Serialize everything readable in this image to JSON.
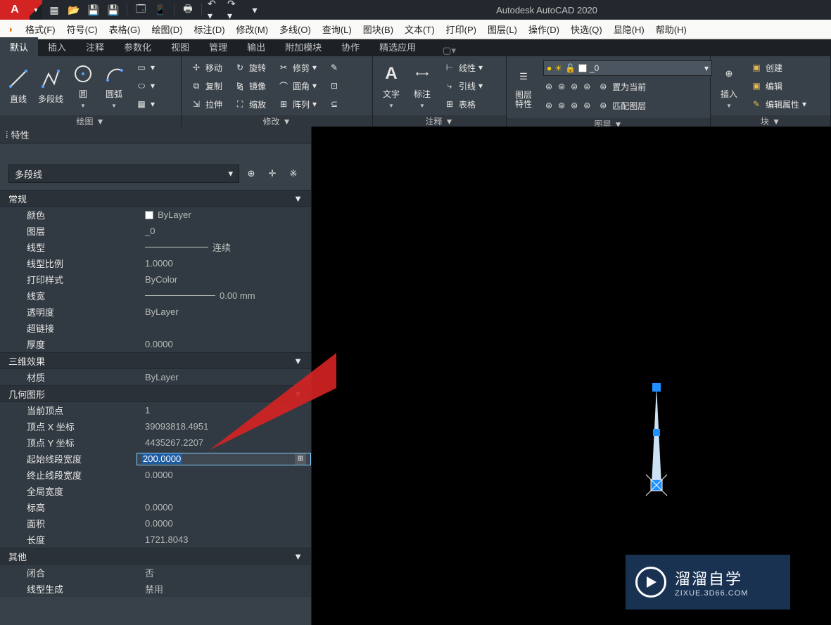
{
  "app": {
    "title": "Autodesk AutoCAD 2020",
    "logo": "A"
  },
  "menubar": [
    "格式(F)",
    "符号(C)",
    "表格(G)",
    "绘图(D)",
    "标注(D)",
    "修改(M)",
    "多线(O)",
    "查询(L)",
    "图块(B)",
    "文本(T)",
    "打印(P)",
    "图层(L)",
    "操作(D)",
    "快选(Q)",
    "显隐(H)",
    "帮助(H)"
  ],
  "ribbon_tabs": [
    "默认",
    "插入",
    "注释",
    "参数化",
    "视图",
    "管理",
    "输出",
    "附加模块",
    "协作",
    "精选应用"
  ],
  "ribbon": {
    "draw": {
      "title": "绘图",
      "btns": [
        "直线",
        "多段线",
        "圆",
        "圆弧"
      ]
    },
    "modify": {
      "title": "修改",
      "move": "移动",
      "rotate": "旋转",
      "trim": "修剪",
      "copy": "复制",
      "mirror": "镜像",
      "fillet": "圆角",
      "stretch": "拉伸",
      "scale": "缩放",
      "array": "阵列"
    },
    "annotate": {
      "title": "注释",
      "text": "文字",
      "dim": "标注",
      "linear": "线性",
      "leader": "引线",
      "table": "表格"
    },
    "layers": {
      "title": "图层",
      "lprop": "图层\n特性",
      "current": "置为当前",
      "match": "匹配图层",
      "dd_value": "_0"
    },
    "block": {
      "title": "块",
      "insert": "插入",
      "create": "创建",
      "edit": "编辑",
      "attr": "编辑属性"
    }
  },
  "properties": {
    "title": "特性",
    "object_type": "多段线",
    "groups": {
      "general": {
        "title": "常规",
        "rows": [
          {
            "label": "颜色",
            "value": "ByLayer",
            "swatch": true
          },
          {
            "label": "图层",
            "value": "_0"
          },
          {
            "label": "线型",
            "value": "连续",
            "linetype": true
          },
          {
            "label": "线型比例",
            "value": "1.0000"
          },
          {
            "label": "打印样式",
            "value": "ByColor"
          },
          {
            "label": "线宽",
            "value": "0.00 mm",
            "lineweight": true
          },
          {
            "label": "透明度",
            "value": "ByLayer"
          },
          {
            "label": "超链接",
            "value": ""
          },
          {
            "label": "厚度",
            "value": "0.0000"
          }
        ]
      },
      "threeD": {
        "title": "三维效果",
        "rows": [
          {
            "label": "材质",
            "value": "ByLayer"
          }
        ]
      },
      "geometry": {
        "title": "几何图形",
        "rows": [
          {
            "label": "当前顶点",
            "value": "1"
          },
          {
            "label": "顶点 X 坐标",
            "value": "39093818.4951"
          },
          {
            "label": "顶点 Y 坐标",
            "value": "4435267.2207"
          },
          {
            "label": "起始线段宽度",
            "value": "200.0000",
            "editing": true
          },
          {
            "label": "终止线段宽度",
            "value": "0.0000"
          },
          {
            "label": "全局宽度",
            "value": ""
          },
          {
            "label": "标高",
            "value": "0.0000"
          },
          {
            "label": "面积",
            "value": "0.0000"
          },
          {
            "label": "长度",
            "value": "1721.8043"
          }
        ]
      },
      "other": {
        "title": "其他",
        "rows": [
          {
            "label": "闭合",
            "value": "否"
          },
          {
            "label": "线型生成",
            "value": "禁用"
          }
        ]
      }
    }
  },
  "watermark": {
    "line1": "溜溜自学",
    "line2": "ZIXUE.3D66.COM"
  }
}
